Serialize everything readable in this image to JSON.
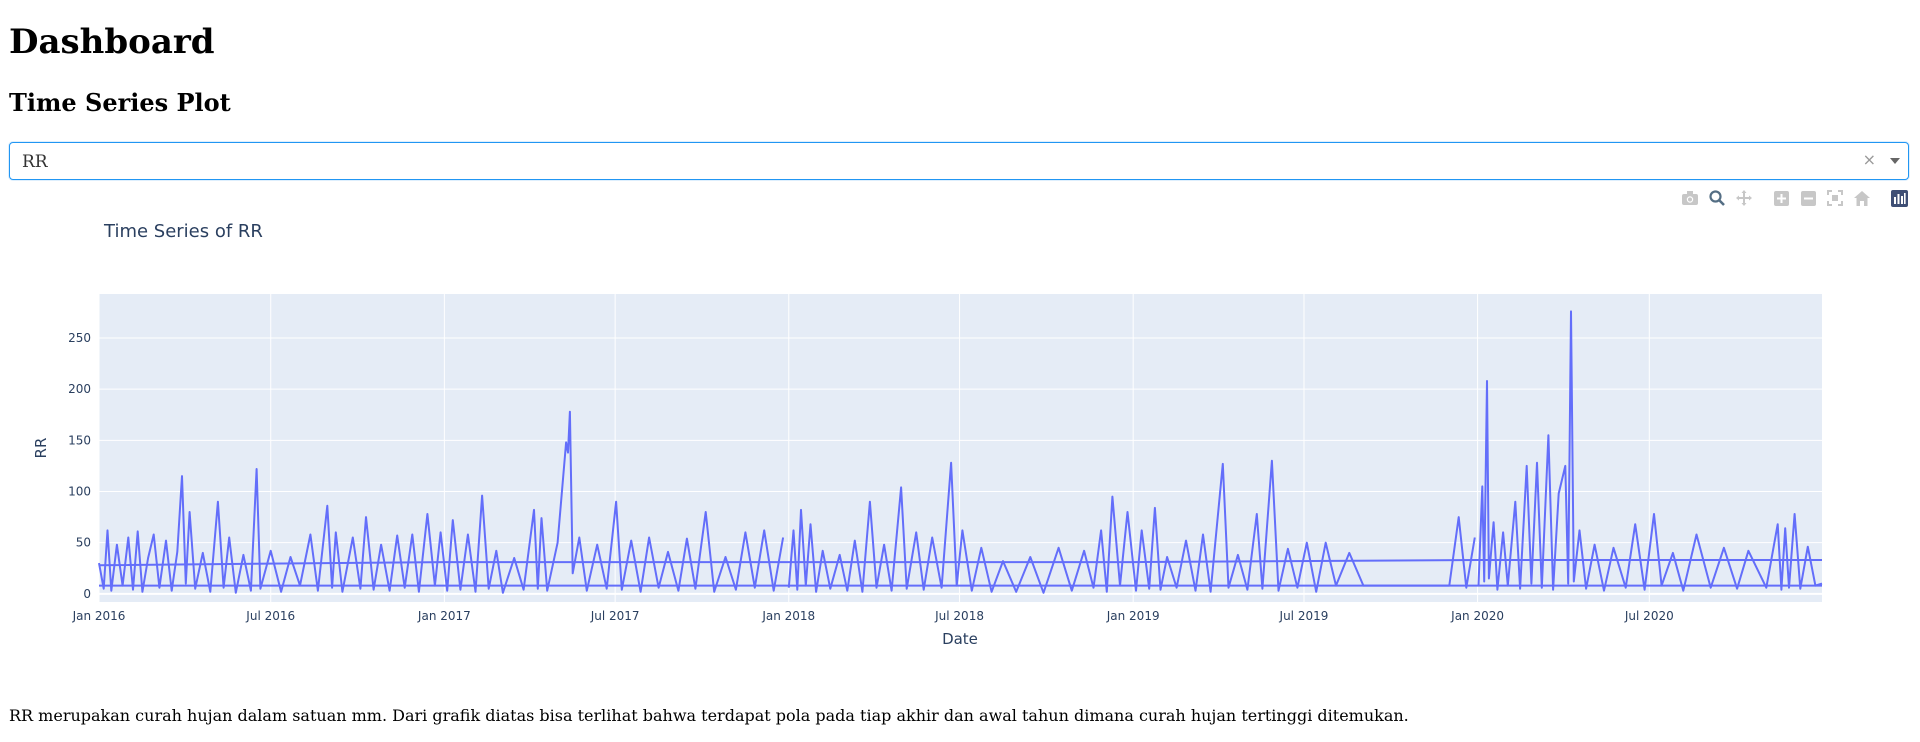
{
  "page": {
    "heading": "Dashboard",
    "subheading": "Time Series Plot",
    "caption": "RR merupakan curah hujan dalam satuan mm. Dari grafik diatas bisa terlihat bahwa terdapat pola pada tiap akhir dan awal tahun dimana curah hujan tertinggi ditemukan."
  },
  "dropdown": {
    "selected": "RR",
    "clear_icon": "×",
    "caret_icon": "chevron-down-icon"
  },
  "modebar": {
    "buttons": [
      "camera-icon",
      "zoom-icon",
      "pan-icon",
      "zoom-in-icon",
      "zoom-out-icon",
      "autoscale-icon",
      "reset-axes-icon",
      "plotly-logo-icon"
    ]
  },
  "chart_data": {
    "type": "line",
    "title": "Time Series of RR",
    "xlabel": "Date",
    "ylabel": "RR",
    "x_range": [
      "2016-01-01",
      "2020-12-31"
    ],
    "ylim": [
      -8,
      293
    ],
    "y_ticks": [
      0,
      50,
      100,
      150,
      200,
      250
    ],
    "x_ticks": [
      {
        "date": "2016-01-01",
        "label": "Jan 2016"
      },
      {
        "date": "2016-07-01",
        "label": "Jul 2016"
      },
      {
        "date": "2017-01-01",
        "label": "Jan 2017"
      },
      {
        "date": "2017-07-01",
        "label": "Jul 2017"
      },
      {
        "date": "2018-01-01",
        "label": "Jan 2018"
      },
      {
        "date": "2018-07-01",
        "label": "Jul 2018"
      },
      {
        "date": "2019-01-01",
        "label": "Jan 2019"
      },
      {
        "date": "2019-07-01",
        "label": "Jul 2019"
      },
      {
        "date": "2020-01-01",
        "label": "Jan 2020"
      },
      {
        "date": "2020-07-01",
        "label": "Jul 2020"
      }
    ],
    "line_color": "#636efa",
    "plot_bg": "#e5ecf6",
    "grid": true,
    "series": [
      {
        "values": [
          [
            "2016-01-01",
            30
          ],
          [
            "2016-01-06",
            5
          ],
          [
            "2016-01-10",
            62
          ],
          [
            "2016-01-14",
            3
          ],
          [
            "2016-01-20",
            48
          ],
          [
            "2016-01-26",
            8
          ],
          [
            "2016-02-01",
            55
          ],
          [
            "2016-02-06",
            4
          ],
          [
            "2016-02-11",
            61
          ],
          [
            "2016-02-16",
            2
          ],
          [
            "2016-02-22",
            35
          ],
          [
            "2016-02-28",
            58
          ],
          [
            "2016-03-05",
            6
          ],
          [
            "2016-03-12",
            52
          ],
          [
            "2016-03-18",
            3
          ],
          [
            "2016-03-24",
            41
          ],
          [
            "2016-03-29",
            115
          ],
          [
            "2016-04-02",
            10
          ],
          [
            "2016-04-06",
            80
          ],
          [
            "2016-04-12",
            5
          ],
          [
            "2016-04-20",
            40
          ],
          [
            "2016-04-28",
            2
          ],
          [
            "2016-05-06",
            90
          ],
          [
            "2016-05-12",
            6
          ],
          [
            "2016-05-18",
            55
          ],
          [
            "2016-05-25",
            1
          ],
          [
            "2016-06-02",
            38
          ],
          [
            "2016-06-10",
            3
          ],
          [
            "2016-06-16",
            122
          ],
          [
            "2016-06-20",
            5
          ],
          [
            "2016-07-01",
            42
          ],
          [
            "2016-07-12",
            2
          ],
          [
            "2016-07-22",
            36
          ],
          [
            "2016-08-01",
            8
          ],
          [
            "2016-08-12",
            58
          ],
          [
            "2016-08-20",
            3
          ],
          [
            "2016-08-30",
            86
          ],
          [
            "2016-09-04",
            6
          ],
          [
            "2016-09-08",
            60
          ],
          [
            "2016-09-15",
            2
          ],
          [
            "2016-09-26",
            55
          ],
          [
            "2016-10-04",
            5
          ],
          [
            "2016-10-10",
            75
          ],
          [
            "2016-10-18",
            4
          ],
          [
            "2016-10-26",
            48
          ],
          [
            "2016-11-04",
            3
          ],
          [
            "2016-11-12",
            57
          ],
          [
            "2016-11-20",
            6
          ],
          [
            "2016-11-28",
            58
          ],
          [
            "2016-12-05",
            2
          ],
          [
            "2016-12-14",
            78
          ],
          [
            "2016-12-22",
            8
          ],
          [
            "2016-12-28",
            60
          ],
          [
            "2017-01-04",
            3
          ],
          [
            "2017-01-10",
            72
          ],
          [
            "2017-01-18",
            4
          ],
          [
            "2017-01-26",
            58
          ],
          [
            "2017-02-03",
            2
          ],
          [
            "2017-02-10",
            96
          ],
          [
            "2017-02-17",
            5
          ],
          [
            "2017-02-25",
            42
          ],
          [
            "2017-03-04",
            1
          ],
          [
            "2017-03-16",
            35
          ],
          [
            "2017-03-26",
            4
          ],
          [
            "2017-04-06",
            82
          ],
          [
            "2017-04-10",
            5
          ],
          [
            "2017-04-14",
            74
          ],
          [
            "2017-04-20",
            3
          ],
          [
            "2017-05-01",
            50
          ],
          [
            "2017-05-10",
            148
          ],
          [
            "2017-05-12",
            138
          ],
          [
            "2017-05-14",
            178
          ],
          [
            "2017-05-17",
            20
          ],
          [
            "2017-05-24",
            55
          ],
          [
            "2017-06-01",
            3
          ],
          [
            "2017-06-12",
            48
          ],
          [
            "2017-06-22",
            5
          ],
          [
            "2017-07-02",
            90
          ],
          [
            "2017-07-08",
            4
          ],
          [
            "2017-07-18",
            52
          ],
          [
            "2017-07-28",
            2
          ],
          [
            "2017-08-06",
            55
          ],
          [
            "2017-08-16",
            6
          ],
          [
            "2017-08-26",
            41
          ],
          [
            "2017-09-06",
            3
          ],
          [
            "2017-09-15",
            54
          ],
          [
            "2017-09-24",
            5
          ],
          [
            "2017-10-05",
            80
          ],
          [
            "2017-10-14",
            2
          ],
          [
            "2017-10-26",
            36
          ],
          [
            "2017-11-06",
            4
          ],
          [
            "2017-11-16",
            60
          ],
          [
            "2017-11-26",
            6
          ],
          [
            "2017-12-06",
            62
          ],
          [
            "2017-12-16",
            3
          ],
          [
            "2017-12-26",
            55
          ]
        ]
      },
      {
        "values": [
          [
            "2018-01-01",
            6
          ],
          [
            "2018-01-06",
            62
          ],
          [
            "2018-01-10",
            4
          ],
          [
            "2018-01-14",
            82
          ],
          [
            "2018-01-19",
            8
          ],
          [
            "2018-01-24",
            68
          ],
          [
            "2018-01-30",
            2
          ],
          [
            "2018-02-06",
            42
          ],
          [
            "2018-02-14",
            5
          ],
          [
            "2018-02-24",
            38
          ],
          [
            "2018-03-04",
            3
          ],
          [
            "2018-03-12",
            52
          ],
          [
            "2018-03-20",
            2
          ],
          [
            "2018-03-28",
            90
          ],
          [
            "2018-04-04",
            6
          ],
          [
            "2018-04-12",
            48
          ],
          [
            "2018-04-20",
            3
          ],
          [
            "2018-04-30",
            104
          ],
          [
            "2018-05-06",
            5
          ],
          [
            "2018-05-16",
            60
          ],
          [
            "2018-05-24",
            4
          ],
          [
            "2018-06-02",
            55
          ],
          [
            "2018-06-12",
            6
          ],
          [
            "2018-06-22",
            128
          ],
          [
            "2018-06-28",
            8
          ],
          [
            "2018-07-04",
            62
          ],
          [
            "2018-07-14",
            3
          ],
          [
            "2018-07-24",
            45
          ],
          [
            "2018-08-04",
            2
          ],
          [
            "2018-08-16",
            32
          ],
          [
            "2018-08-30",
            2
          ],
          [
            "2018-09-14",
            36
          ],
          [
            "2018-09-28",
            1
          ],
          [
            "2018-10-14",
            45
          ],
          [
            "2018-10-28",
            3
          ],
          [
            "2018-11-10",
            42
          ],
          [
            "2018-11-20",
            6
          ],
          [
            "2018-11-28",
            62
          ],
          [
            "2018-12-04",
            2
          ],
          [
            "2018-12-10",
            95
          ],
          [
            "2018-12-18",
            8
          ],
          [
            "2018-12-26",
            80
          ],
          [
            "2019-01-04",
            3
          ],
          [
            "2019-01-10",
            62
          ],
          [
            "2019-01-18",
            5
          ],
          [
            "2019-01-24",
            84
          ],
          [
            "2019-01-30",
            4
          ],
          [
            "2019-02-06",
            36
          ],
          [
            "2019-02-16",
            6
          ],
          [
            "2019-02-26",
            52
          ],
          [
            "2019-03-08",
            3
          ],
          [
            "2019-03-16",
            58
          ],
          [
            "2019-03-24",
            2
          ],
          [
            "2019-04-06",
            127
          ],
          [
            "2019-04-12",
            6
          ],
          [
            "2019-04-22",
            38
          ],
          [
            "2019-05-02",
            4
          ],
          [
            "2019-05-12",
            78
          ],
          [
            "2019-05-18",
            5
          ],
          [
            "2019-05-28",
            130
          ],
          [
            "2019-06-04",
            3
          ],
          [
            "2019-06-14",
            44
          ],
          [
            "2019-06-24",
            6
          ],
          [
            "2019-07-04",
            50
          ],
          [
            "2019-07-14",
            2
          ],
          [
            "2019-07-24",
            50
          ],
          [
            "2019-08-04",
            8
          ],
          [
            "2019-08-18",
            40
          ],
          [
            "2019-09-02",
            8
          ],
          [
            "2019-10-02",
            8
          ],
          [
            "2019-11-02",
            8
          ],
          [
            "2019-12-02",
            8
          ],
          [
            "2019-12-12",
            75
          ],
          [
            "2019-12-20",
            6
          ],
          [
            "2019-12-29",
            55
          ]
        ]
      },
      {
        "values": [
          [
            "2020-01-02",
            8
          ],
          [
            "2020-01-06",
            105
          ],
          [
            "2020-01-08",
            12
          ],
          [
            "2020-01-11",
            208
          ],
          [
            "2020-01-13",
            15
          ],
          [
            "2020-01-18",
            70
          ],
          [
            "2020-01-22",
            4
          ],
          [
            "2020-01-28",
            60
          ],
          [
            "2020-02-02",
            8
          ],
          [
            "2020-02-10",
            90
          ],
          [
            "2020-02-15",
            5
          ],
          [
            "2020-02-22",
            125
          ],
          [
            "2020-02-27",
            10
          ],
          [
            "2020-03-04",
            128
          ],
          [
            "2020-03-09",
            6
          ],
          [
            "2020-03-16",
            155
          ],
          [
            "2020-03-21",
            4
          ],
          [
            "2020-03-27",
            98
          ],
          [
            "2020-04-03",
            125
          ],
          [
            "2020-04-06",
            10
          ],
          [
            "2020-04-09",
            276
          ],
          [
            "2020-04-12",
            12
          ],
          [
            "2020-04-18",
            62
          ],
          [
            "2020-04-25",
            5
          ],
          [
            "2020-05-04",
            48
          ],
          [
            "2020-05-14",
            3
          ],
          [
            "2020-05-24",
            45
          ],
          [
            "2020-06-06",
            6
          ],
          [
            "2020-06-16",
            68
          ],
          [
            "2020-06-26",
            4
          ],
          [
            "2020-07-06",
            78
          ],
          [
            "2020-07-14",
            8
          ],
          [
            "2020-07-26",
            40
          ],
          [
            "2020-08-06",
            3
          ],
          [
            "2020-08-20",
            58
          ],
          [
            "2020-09-04",
            6
          ],
          [
            "2020-09-18",
            45
          ],
          [
            "2020-10-02",
            5
          ],
          [
            "2020-10-14",
            42
          ],
          [
            "2020-11-02",
            6
          ],
          [
            "2020-11-14",
            68
          ],
          [
            "2020-11-18",
            4
          ],
          [
            "2020-11-22",
            64
          ],
          [
            "2020-11-26",
            6
          ],
          [
            "2020-12-02",
            78
          ],
          [
            "2020-12-08",
            5
          ],
          [
            "2020-12-16",
            46
          ],
          [
            "2020-12-24",
            8
          ],
          [
            "2020-12-31",
            10
          ]
        ]
      },
      {
        "values": [
          [
            "2016-01-01",
            28
          ],
          [
            "2017-01-01",
            31
          ],
          [
            "2018-01-01",
            31
          ],
          [
            "2019-01-01",
            31
          ],
          [
            "2020-01-01",
            33
          ],
          [
            "2020-12-31",
            33
          ]
        ]
      },
      {
        "values": [
          [
            "2016-01-01",
            8
          ],
          [
            "2017-01-01",
            8
          ],
          [
            "2018-01-01",
            8
          ],
          [
            "2019-01-01",
            8
          ],
          [
            "2020-01-01",
            8
          ],
          [
            "2020-12-31",
            8
          ]
        ]
      }
    ]
  }
}
